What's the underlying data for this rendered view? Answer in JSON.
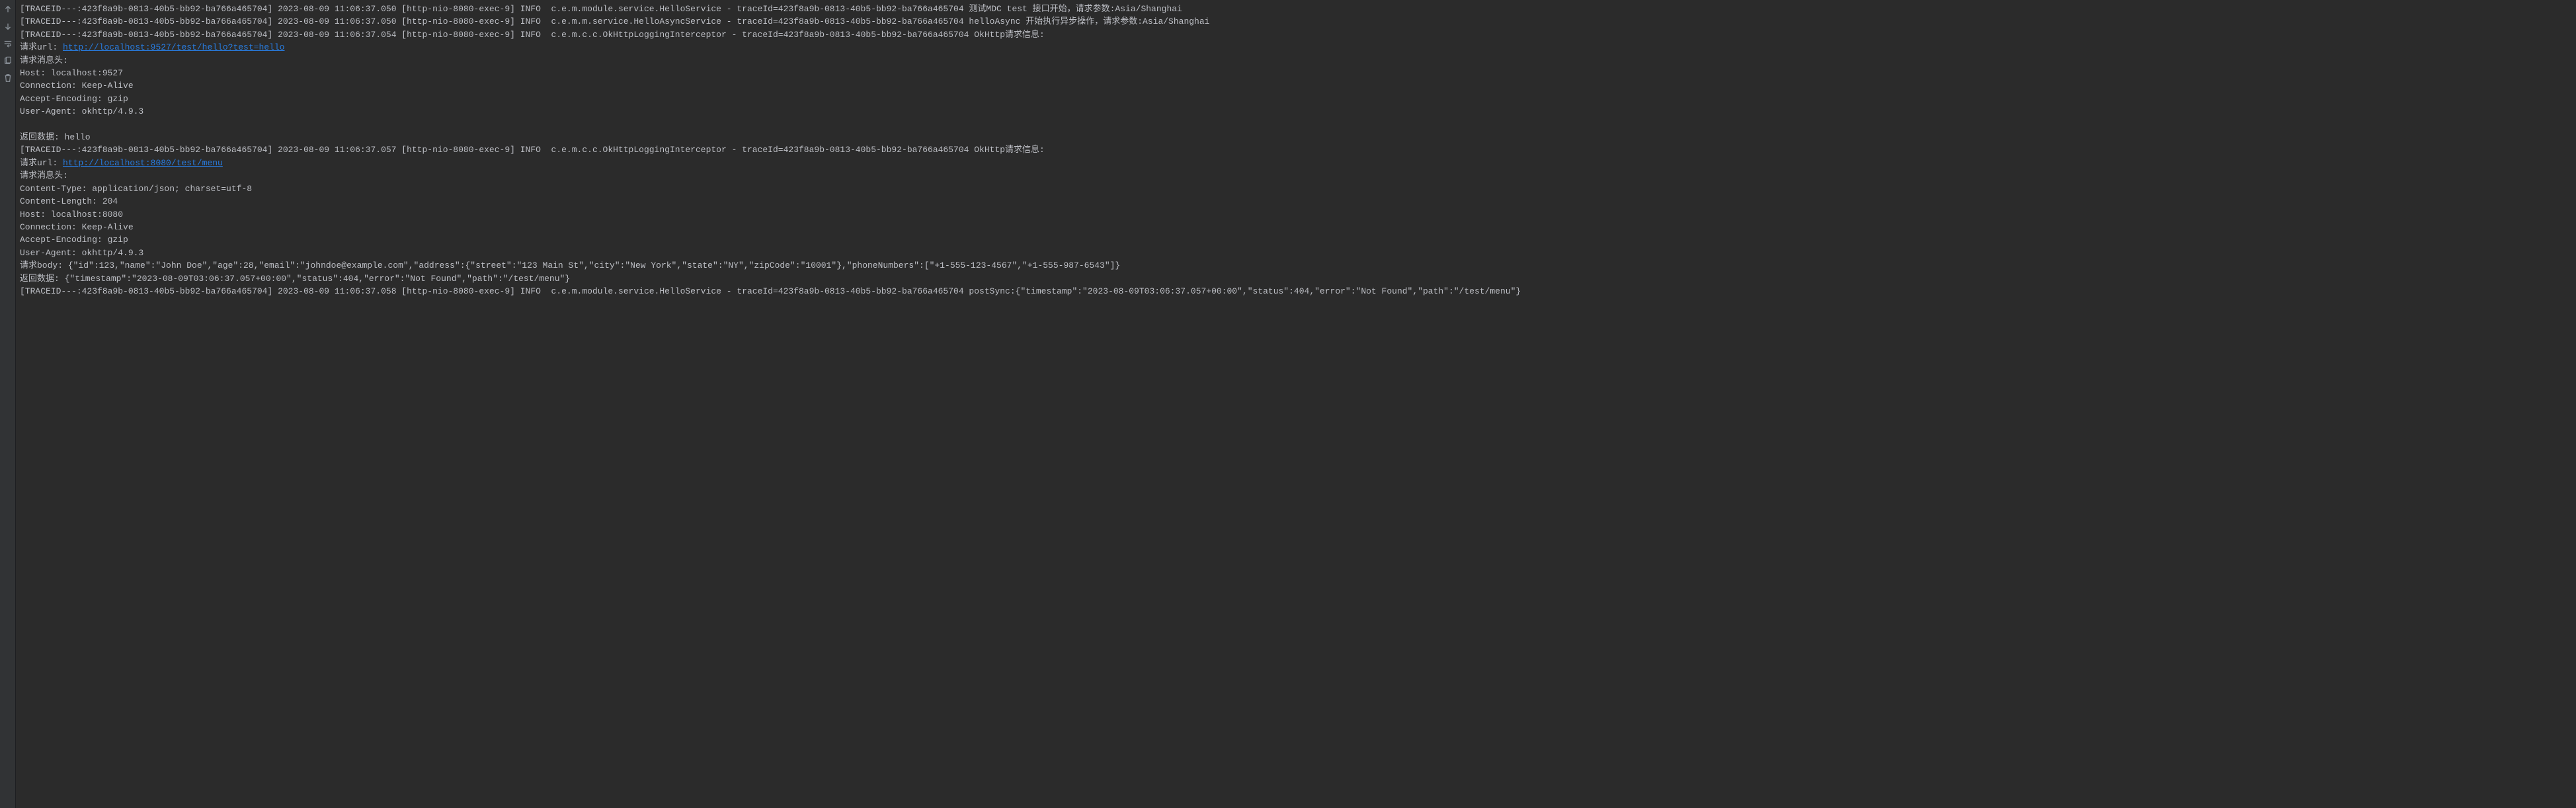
{
  "gutter": {
    "icons": [
      {
        "name": "scroll-up-icon"
      },
      {
        "name": "scroll-down-icon"
      },
      {
        "name": "wrap-icon"
      },
      {
        "name": "clipboard-icon"
      },
      {
        "name": "trash-icon"
      }
    ]
  },
  "log": {
    "blocks": [
      {
        "type": "text",
        "value": "[TRACEID---:423f8a9b-0813-40b5-bb92-ba766a465704] 2023-08-09 11:06:37.050 [http-nio-8080-exec-9] INFO  c.e.m.module.service.HelloService - traceId=423f8a9b-0813-40b5-bb92-ba766a465704 测试MDC test 接口开始，请求参数:Asia/Shanghai\n[TRACEID---:423f8a9b-0813-40b5-bb92-ba766a465704] 2023-08-09 11:06:37.050 [http-nio-8080-exec-9] INFO  c.e.m.m.service.HelloAsyncService - traceId=423f8a9b-0813-40b5-bb92-ba766a465704 helloAsync 开始执行异步操作，请求参数:Asia/Shanghai\n[TRACEID---:423f8a9b-0813-40b5-bb92-ba766a465704] 2023-08-09 11:06:37.054 [http-nio-8080-exec-9] INFO  c.e.m.c.c.OkHttpLoggingInterceptor - traceId=423f8a9b-0813-40b5-bb92-ba766a465704 OkHttp请求信息:\n请求url: "
      },
      {
        "type": "link",
        "value": "http://localhost:9527/test/hello?test=hello"
      },
      {
        "type": "text",
        "value": "\n请求消息头:\nHost: localhost:9527\nConnection: Keep-Alive\nAccept-Encoding: gzip\nUser-Agent: okhttp/4.9.3\n\n返回数据: hello\n[TRACEID---:423f8a9b-0813-40b5-bb92-ba766a465704] 2023-08-09 11:06:37.057 [http-nio-8080-exec-9] INFO  c.e.m.c.c.OkHttpLoggingInterceptor - traceId=423f8a9b-0813-40b5-bb92-ba766a465704 OkHttp请求信息:\n请求url: "
      },
      {
        "type": "link",
        "value": "http://localhost:8080/test/menu"
      },
      {
        "type": "text",
        "value": "\n请求消息头:\nContent-Type: application/json; charset=utf-8\nContent-Length: 204\nHost: localhost:8080\nConnection: Keep-Alive\nAccept-Encoding: gzip\nUser-Agent: okhttp/4.9.3\n请求body: {\"id\":123,\"name\":\"John Doe\",\"age\":28,\"email\":\"johndoe@example.com\",\"address\":{\"street\":\"123 Main St\",\"city\":\"New York\",\"state\":\"NY\",\"zipCode\":\"10001\"},\"phoneNumbers\":[\"+1-555-123-4567\",\"+1-555-987-6543\"]}\n返回数据: {\"timestamp\":\"2023-08-09T03:06:37.057+00:00\",\"status\":404,\"error\":\"Not Found\",\"path\":\"/test/menu\"}\n[TRACEID---:423f8a9b-0813-40b5-bb92-ba766a465704] 2023-08-09 11:06:37.058 [http-nio-8080-exec-9] INFO  c.e.m.module.service.HelloService - traceId=423f8a9b-0813-40b5-bb92-ba766a465704 postSync:{\"timestamp\":\"2023-08-09T03:06:37.057+00:00\",\"status\":404,\"error\":\"Not Found\",\"path\":\"/test/menu\"}"
      }
    ]
  }
}
